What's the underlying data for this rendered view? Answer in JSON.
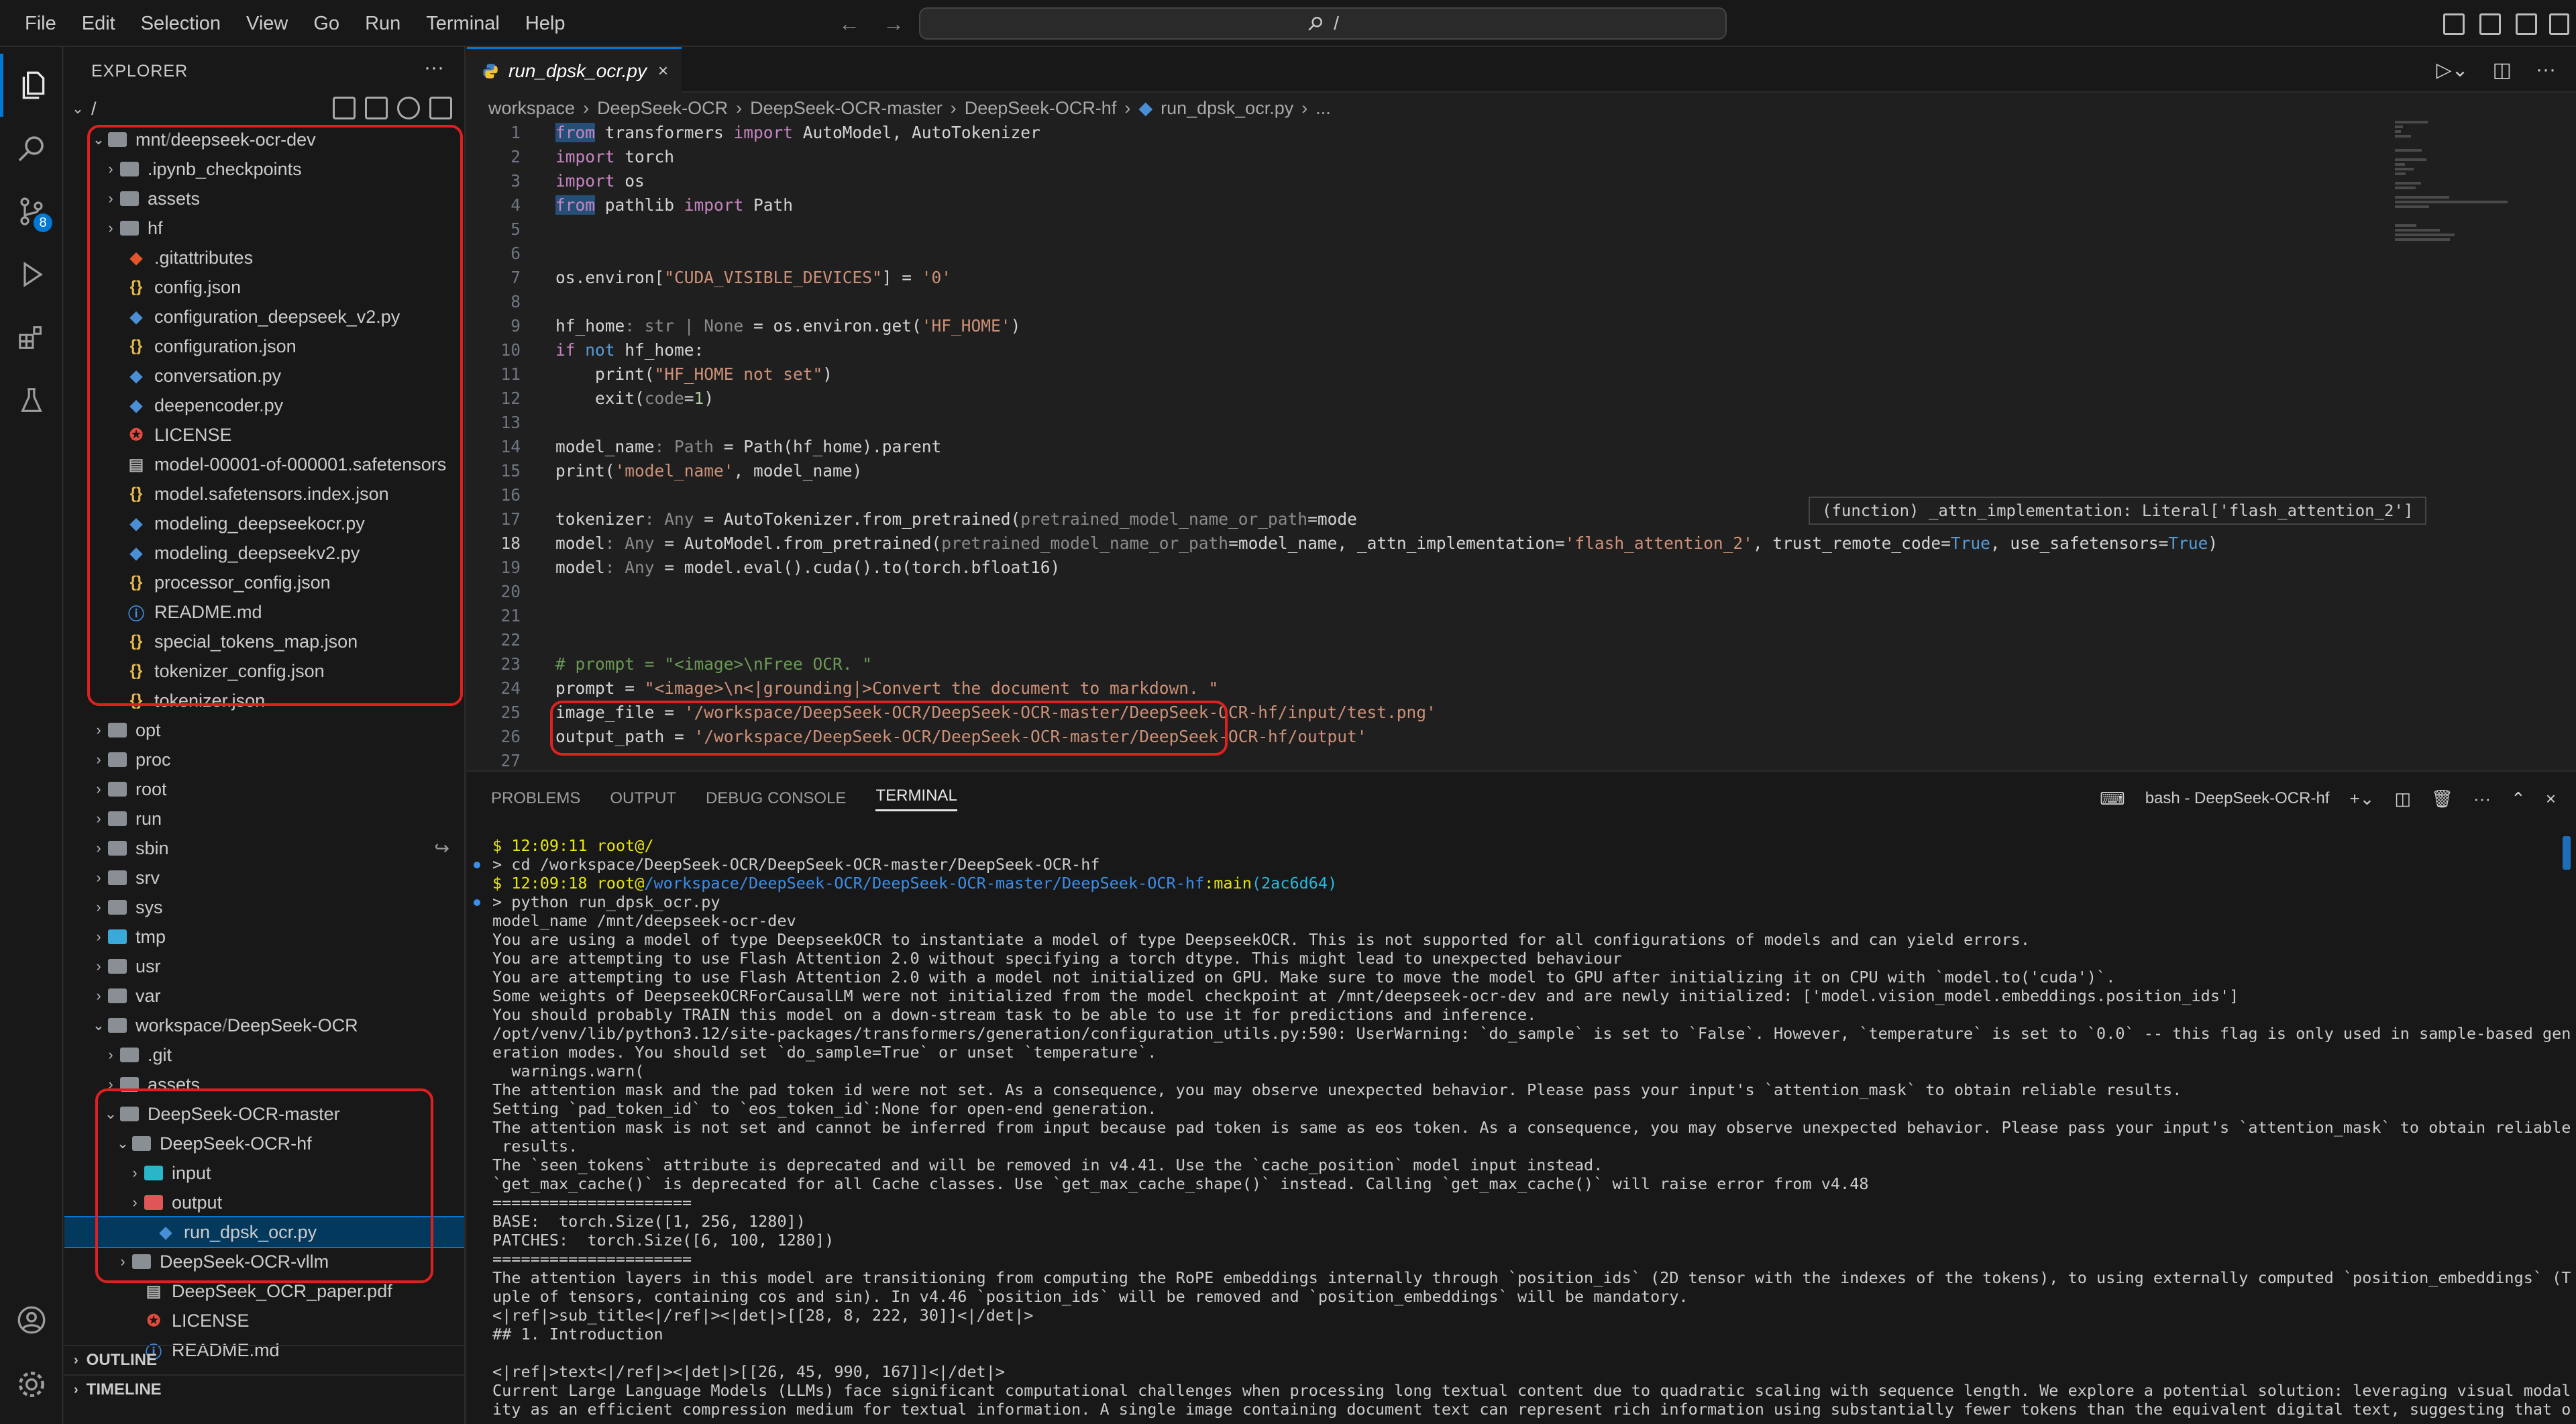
{
  "menu": [
    "File",
    "Edit",
    "Selection",
    "View",
    "Go",
    "Run",
    "Terminal",
    "Help"
  ],
  "search": {
    "text": "/"
  },
  "activity_badge": "8",
  "explorer": {
    "header": "EXPLORER",
    "root": "/",
    "mnt_folder": "mnt",
    "mnt_sub": "deepseek-ocr-dev",
    "mnt_items": [
      {
        "label": ".ipynb_checkpoints",
        "kind": "folder"
      },
      {
        "label": "assets",
        "kind": "folder"
      },
      {
        "label": "hf",
        "kind": "folder"
      },
      {
        "label": ".gitattributes",
        "kind": "git"
      },
      {
        "label": "config.json",
        "kind": "json"
      },
      {
        "label": "configuration_deepseek_v2.py",
        "kind": "py"
      },
      {
        "label": "configuration.json",
        "kind": "json"
      },
      {
        "label": "conversation.py",
        "kind": "py"
      },
      {
        "label": "deepencoder.py",
        "kind": "py"
      },
      {
        "label": "LICENSE",
        "kind": "license"
      },
      {
        "label": "model-00001-of-000001.safetensors",
        "kind": "file"
      },
      {
        "label": "model.safetensors.index.json",
        "kind": "json"
      },
      {
        "label": "modeling_deepseekocr.py",
        "kind": "py"
      },
      {
        "label": "modeling_deepseekv2.py",
        "kind": "py"
      },
      {
        "label": "processor_config.json",
        "kind": "json"
      },
      {
        "label": "README.md",
        "kind": "info"
      },
      {
        "label": "special_tokens_map.json",
        "kind": "json"
      },
      {
        "label": "tokenizer_config.json",
        "kind": "json"
      },
      {
        "label": "tokenizer.json",
        "kind": "json"
      }
    ],
    "root_items": [
      "opt",
      "proc",
      "root",
      "run",
      "sbin",
      "srv",
      "sys",
      "tmp",
      "usr",
      "var"
    ],
    "workspace_folder": "workspace",
    "workspace_sub": "DeepSeek-OCR",
    "ws_items": [
      ".git",
      "assets"
    ],
    "ocr_master": "DeepSeek-OCR-master",
    "ocr_hf": "DeepSeek-OCR-hf",
    "hf_items": [
      "input",
      "output"
    ],
    "active_file": "run_dpsk_ocr.py",
    "after_items": [
      {
        "label": "DeepSeek-OCR-vllm",
        "kind": "folder"
      },
      {
        "label": "DeepSeek_OCR_paper.pdf",
        "kind": "pdf"
      },
      {
        "label": "LICENSE",
        "kind": "license"
      },
      {
        "label": "README.md",
        "kind": "info"
      }
    ],
    "outline": "OUTLINE",
    "timeline": "TIMELINE"
  },
  "editor": {
    "tab": "run_dpsk_ocr.py",
    "breadcrumbs": [
      "workspace",
      "DeepSeek-OCR",
      "DeepSeek-OCR-master",
      "DeepSeek-OCR-hf",
      "run_dpsk_ocr.py",
      "..."
    ],
    "tooltip": "(function) _attn_implementation: Literal['flash_attention_2']"
  },
  "code_lines": [
    [
      [
        "kw kwsel",
        "from"
      ],
      [
        "",
        ""
      ],
      [
        "",
        " transformers "
      ],
      [
        "kw",
        "import"
      ],
      [
        "",
        " AutoModel, AutoTokenizer"
      ]
    ],
    [
      [
        "kw",
        "import"
      ],
      [
        "",
        " torch"
      ]
    ],
    [
      [
        "kw",
        "import"
      ],
      [
        "",
        " os"
      ]
    ],
    [
      [
        "kw kwsel",
        "from"
      ],
      [
        "",
        " pathlib "
      ],
      [
        "kw",
        "import"
      ],
      [
        "",
        " Path"
      ]
    ],
    [],
    [],
    [
      [
        "",
        "os.environ["
      ],
      [
        "str",
        "\"CUDA_VISIBLE_DEVICES\""
      ],
      [
        "",
        "] = "
      ],
      [
        "str",
        "'0'"
      ]
    ],
    [],
    [
      [
        "",
        "hf_home"
      ],
      [
        "dim",
        ": str | None"
      ],
      [
        "",
        " = os.environ.get("
      ],
      [
        "str",
        "'HF_HOME'"
      ],
      [
        "",
        ")"
      ]
    ],
    [
      [
        "kw",
        "if"
      ],
      [
        "bl",
        " not"
      ],
      [
        "",
        " hf_home:"
      ]
    ],
    [
      [
        "",
        "    print("
      ],
      [
        "str",
        "\"HF_HOME not set\""
      ],
      [
        "",
        ")"
      ]
    ],
    [
      [
        "",
        "    exit("
      ],
      [
        "dim",
        "code"
      ],
      [
        "",
        "="
      ],
      [
        "num",
        "1"
      ],
      [
        "",
        ")"
      ]
    ],
    [],
    [
      [
        "",
        "model_name"
      ],
      [
        "dim",
        ": Path"
      ],
      [
        "",
        " = Path(hf_home).parent"
      ]
    ],
    [
      [
        "",
        "print("
      ],
      [
        "str",
        "'model_name'"
      ],
      [
        "",
        ", model_name)"
      ]
    ],
    [],
    [
      [
        "",
        "tokenizer"
      ],
      [
        "dim",
        ": Any"
      ],
      [
        "",
        " = AutoTokenizer.from_pretrained("
      ],
      [
        "dim",
        "pretrained_model_name_or_path"
      ],
      [
        "",
        "=mode"
      ]
    ],
    [
      [
        "",
        "model"
      ],
      [
        "dim",
        ": Any"
      ],
      [
        "",
        " = AutoModel.from_pretrained("
      ],
      [
        "dim",
        "pretrained_model_name_or_path"
      ],
      [
        "",
        "=model_name, _attn_implementation="
      ],
      [
        "str",
        "'flash_attention_2'"
      ],
      [
        "",
        ", trust_remote_code="
      ],
      [
        "bl",
        "True"
      ],
      [
        "",
        ", use_safetensors="
      ],
      [
        "bl",
        "True"
      ],
      [
        "",
        ")"
      ]
    ],
    [
      [
        "",
        "model"
      ],
      [
        "dim",
        ": Any"
      ],
      [
        "",
        " = model.eval().cuda().to(torch.bfloat16)"
      ]
    ],
    [],
    [],
    [],
    [
      [
        "cmt",
        "# prompt = \"<image>\\nFree OCR. \""
      ]
    ],
    [
      [
        "",
        "prompt = "
      ],
      [
        "str",
        "\"<image>\\n<|grounding|>Convert the document to markdown. \""
      ]
    ],
    [
      [
        "",
        "image_file = "
      ],
      [
        "str",
        "'/workspace/DeepSeek-OCR/DeepSeek-OCR-master/DeepSeek-OCR-hf/input/test.png'"
      ]
    ],
    [
      [
        "",
        "output_path = "
      ],
      [
        "str",
        "'/workspace/DeepSeek-OCR/DeepSeek-OCR-master/DeepSeek-OCR-hf/output'"
      ]
    ],
    []
  ],
  "panel": {
    "tabs": [
      "PROBLEMS",
      "OUTPUT",
      "DEBUG CONSOLE",
      "TERMINAL"
    ],
    "terminal_title": "bash - DeepSeek-OCR-hf"
  },
  "terminal_lines": [
    [
      [
        "t-yel",
        "$ 12:09:11 "
      ],
      [
        "t-yel",
        "root"
      ],
      [
        "t-yel",
        "@/"
      ]
    ],
    [
      [
        "",
        "> cd /workspace/DeepSeek-OCR/DeepSeek-OCR-master/DeepSeek-OCR-hf"
      ]
    ],
    [
      [
        "t-yel",
        "$ 12:09:18 "
      ],
      [
        "t-yel",
        "root"
      ],
      [
        "t-yel",
        "@"
      ],
      [
        "t-blu",
        "/workspace/DeepSeek-OCR/DeepSeek-OCR-master/DeepSeek-OCR-hf"
      ],
      [
        "t-yel",
        ":main"
      ],
      [
        "t-cyn",
        "(2ac6d64)"
      ]
    ],
    [
      [
        "",
        "> python run_dpsk_ocr.py"
      ]
    ],
    [
      [
        "",
        "model_name /mnt/deepseek-ocr-dev"
      ]
    ],
    [
      [
        "",
        "You are using a model of type DeepseekOCR to instantiate a model of type DeepseekOCR. This is not supported for all configurations of models and can yield errors."
      ]
    ],
    [
      [
        "",
        "You are attempting to use Flash Attention 2.0 without specifying a torch dtype. This might lead to unexpected behaviour"
      ]
    ],
    [
      [
        "",
        "You are attempting to use Flash Attention 2.0 with a model not initialized on GPU. Make sure to move the model to GPU after initializing it on CPU with `model.to('cuda')`."
      ]
    ],
    [
      [
        "",
        "Some weights of DeepseekOCRForCausalLM were not initialized from the model checkpoint at /mnt/deepseek-ocr-dev and are newly initialized: ['model.vision_model.embeddings.position_ids']"
      ]
    ],
    [
      [
        "",
        "You should probably TRAIN this model on a down-stream task to be able to use it for predictions and inference."
      ]
    ],
    [
      [
        "",
        "/opt/venv/lib/python3.12/site-packages/transformers/generation/configuration_utils.py:590: UserWarning: `do_sample` is set to `False`. However, `temperature` is set to `0.0` -- this flag is only used in sample-based gen"
      ]
    ],
    [
      [
        "",
        "eration modes. You should set `do_sample=True` or unset `temperature`."
      ]
    ],
    [
      [
        "",
        "  warnings.warn("
      ]
    ],
    [
      [
        "",
        "The attention mask and the pad token id were not set. As a consequence, you may observe unexpected behavior. Please pass your input's `attention_mask` to obtain reliable results."
      ]
    ],
    [
      [
        "",
        "Setting `pad_token_id` to `eos_token_id`:None for open-end generation."
      ]
    ],
    [
      [
        "",
        "The attention mask is not set and cannot be inferred from input because pad token is same as eos token. As a consequence, you may observe unexpected behavior. Please pass your input's `attention_mask` to obtain reliable"
      ]
    ],
    [
      [
        "",
        " results."
      ]
    ],
    [
      [
        "",
        "The `seen_tokens` attribute is deprecated and will be removed in v4.41. Use the `cache_position` model input instead."
      ]
    ],
    [
      [
        "",
        "`get_max_cache()` is deprecated for all Cache classes. Use `get_max_cache_shape()` instead. Calling `get_max_cache()` will raise error from v4.48"
      ]
    ],
    [
      [
        "",
        "====================="
      ]
    ],
    [
      [
        "",
        "BASE:  torch.Size([1, 256, 1280])"
      ]
    ],
    [
      [
        "",
        "PATCHES:  torch.Size([6, 100, 1280])"
      ]
    ],
    [
      [
        "",
        "====================="
      ]
    ],
    [
      [
        "",
        "The attention layers in this model are transitioning from computing the RoPE embeddings internally through `position_ids` (2D tensor with the indexes of the tokens), to using externally computed `position_embeddings` (T"
      ]
    ],
    [
      [
        "",
        "uple of tensors, containing cos and sin). In v4.46 `position_ids` will be removed and `position_embeddings` will be mandatory."
      ]
    ],
    [
      [
        "",
        "<|ref|>sub_title<|/ref|><|det|>[[28, 8, 222, 30]]<|/det|>"
      ]
    ],
    [
      [
        "",
        "## 1. Introduction"
      ]
    ],
    [
      [
        "",
        ""
      ]
    ],
    [
      [
        "",
        "<|ref|>text<|/ref|><|det|>[[26, 45, 990, 167]]<|/det|>"
      ]
    ],
    [
      [
        "",
        "Current Large Language Models (LLMs) face significant computational challenges when processing long textual content due to quadratic scaling with sequence length. We explore a potential solution: leveraging visual modal"
      ]
    ],
    [
      [
        "",
        "ity as an efficient compression medium for textual information. A single image containing document text can represent rich information using substantially fewer tokens than the equivalent digital text, suggesting that o"
      ]
    ]
  ]
}
